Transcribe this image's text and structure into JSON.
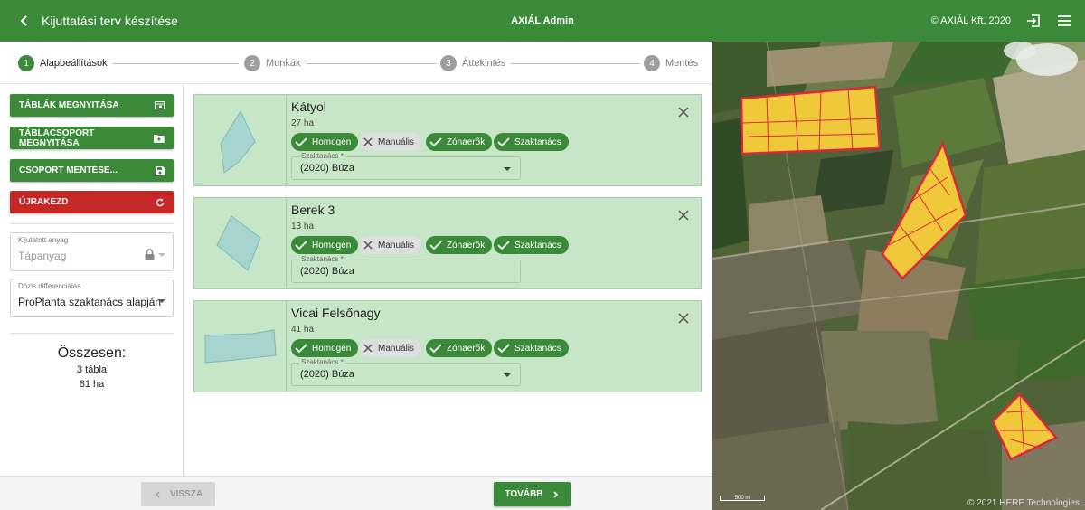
{
  "topbar": {
    "title": "Kijuttatási terv készítése",
    "app_name": "AXIÁL Admin",
    "copyright": "© AXIÁL Kft. 2020"
  },
  "stepper": [
    {
      "num": "1",
      "label": "Alapbeállítások",
      "active": true
    },
    {
      "num": "2",
      "label": "Munkák",
      "active": false
    },
    {
      "num": "3",
      "label": "Áttekintés",
      "active": false
    },
    {
      "num": "4",
      "label": "Mentés",
      "active": false
    }
  ],
  "left": {
    "buttons": [
      {
        "label": "TÁBLÁK MEGNYITÁSA",
        "icon": "table-icon"
      },
      {
        "label": "TÁBLACSOPORT MEGNYITÁSA",
        "icon": "folder-icon"
      },
      {
        "label": "CSOPORT MENTÉSE...",
        "icon": "save-icon"
      },
      {
        "label": "ÚJRAKEZD",
        "icon": "refresh-icon"
      }
    ],
    "material_field": {
      "label": "Kijutatott anyag",
      "value": "Tápanyag"
    },
    "dose_field": {
      "label": "Dózis differenciálás",
      "value": "ProPlanta szaktanács alapján"
    },
    "summary": {
      "title": "Összesen:",
      "tables": "3 tábla",
      "area": "81 ha"
    }
  },
  "cards": [
    {
      "name": "Kátyol",
      "area": "27 ha",
      "select_label": "Szaktanács *",
      "select_value": "(2020) Búza",
      "has_dropdown": true
    },
    {
      "name": "Berek 3",
      "area": "13 ha",
      "select_label": "Szaktanács *",
      "select_value": "(2020) Búza",
      "has_dropdown": false
    },
    {
      "name": "Vicai Felsőnagy",
      "area": "41 ha",
      "select_label": "Szaktanács *",
      "select_value": "(2020) Búza",
      "has_dropdown": true
    }
  ],
  "chips": [
    {
      "label": "Homogén",
      "on": true
    },
    {
      "label": "Manuális",
      "on": false
    },
    {
      "label": "Zónaerők",
      "on": true
    },
    {
      "label": "Szaktanács",
      "on": true
    }
  ],
  "bottom": {
    "back_label": "VISSZA",
    "next_label": "TOVÁBB"
  },
  "map": {
    "attribution": "© 2021 HERE Technologies",
    "scale_label": "500 m"
  },
  "colors": {
    "primary": "#3a8a39",
    "danger": "#c62828",
    "card_bg": "#c7e6c8",
    "field_fill": "#f0c93a",
    "field_border": "#d8283a"
  }
}
